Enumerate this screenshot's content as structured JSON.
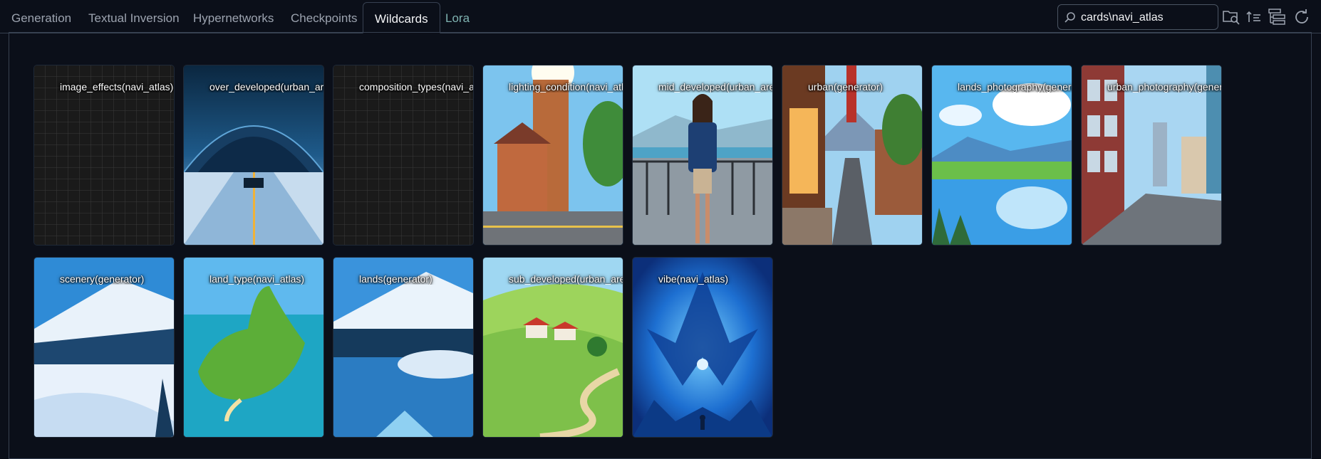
{
  "tabs": [
    {
      "label": "Generation"
    },
    {
      "label": "Textual Inversion"
    },
    {
      "label": "Hypernetworks"
    },
    {
      "label": "Checkpoints"
    },
    {
      "label": "Wildcards"
    },
    {
      "label": "Lora"
    }
  ],
  "active_tab": "Wildcards",
  "search": {
    "value": "cards\\navi_atlas"
  },
  "toolbar_icons": [
    "folder-search-icon",
    "sort-order-icon",
    "tree-view-icon",
    "refresh-icon"
  ],
  "cards": [
    {
      "label": "image_effects(navi_atlas)"
    },
    {
      "label": "over_developed(urban_areas)"
    },
    {
      "label": "composition_types(navi_atlas)"
    },
    {
      "label": "lighting_condition(navi_atlas)"
    },
    {
      "label": "mid_developed(urban_areas)"
    },
    {
      "label": "urban(generator)"
    },
    {
      "label": "lands_photography(generator)"
    },
    {
      "label": "urban_photography(generator)"
    },
    {
      "label": "scenery(generator)"
    },
    {
      "label": "land_type(navi_atlas)"
    },
    {
      "label": "lands(generator)"
    },
    {
      "label": "sub_developed(urban_areas)"
    },
    {
      "label": "vibe(navi_atlas)"
    }
  ]
}
